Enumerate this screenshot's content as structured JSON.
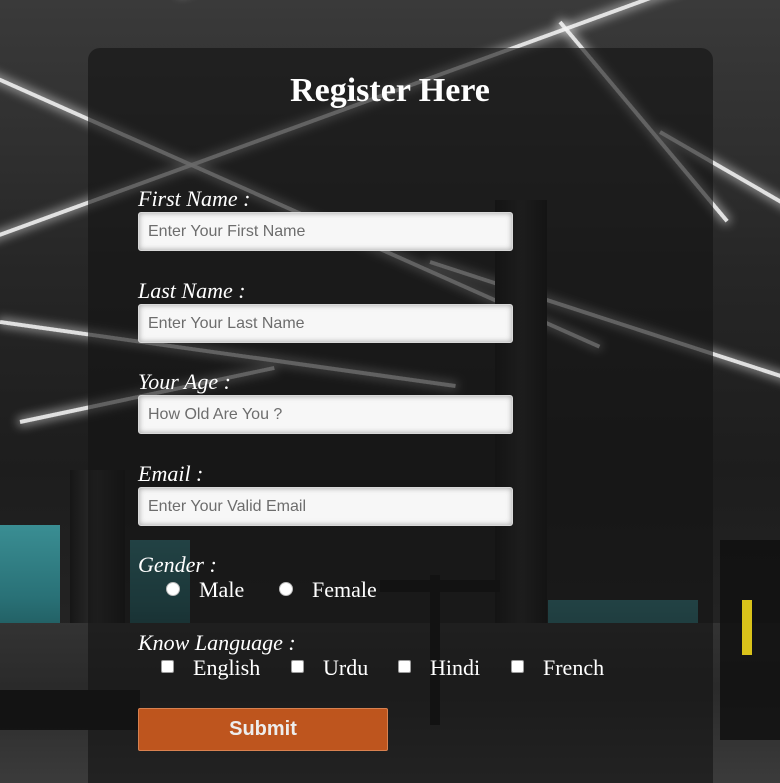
{
  "form": {
    "title": "Register Here",
    "first_name": {
      "label": "First Name :",
      "placeholder": "Enter Your First Name"
    },
    "last_name": {
      "label": "Last Name :",
      "placeholder": "Enter Your Last Name"
    },
    "age": {
      "label": "Your Age :",
      "placeholder": "How Old Are You ?"
    },
    "email": {
      "label": "Email :",
      "placeholder": "Enter Your Valid Email"
    },
    "gender": {
      "label": "Gender :",
      "options": [
        "Male",
        "Female"
      ]
    },
    "language": {
      "label": "Know Language :",
      "options": [
        "English",
        "Urdu",
        "Hindi",
        "French"
      ]
    },
    "submit_label": "Submit"
  },
  "colors": {
    "submit_button": "#cc5a1e",
    "card_overlay": "rgba(20,20,20,0.62)",
    "locker_accent": "#3d9aa0"
  }
}
